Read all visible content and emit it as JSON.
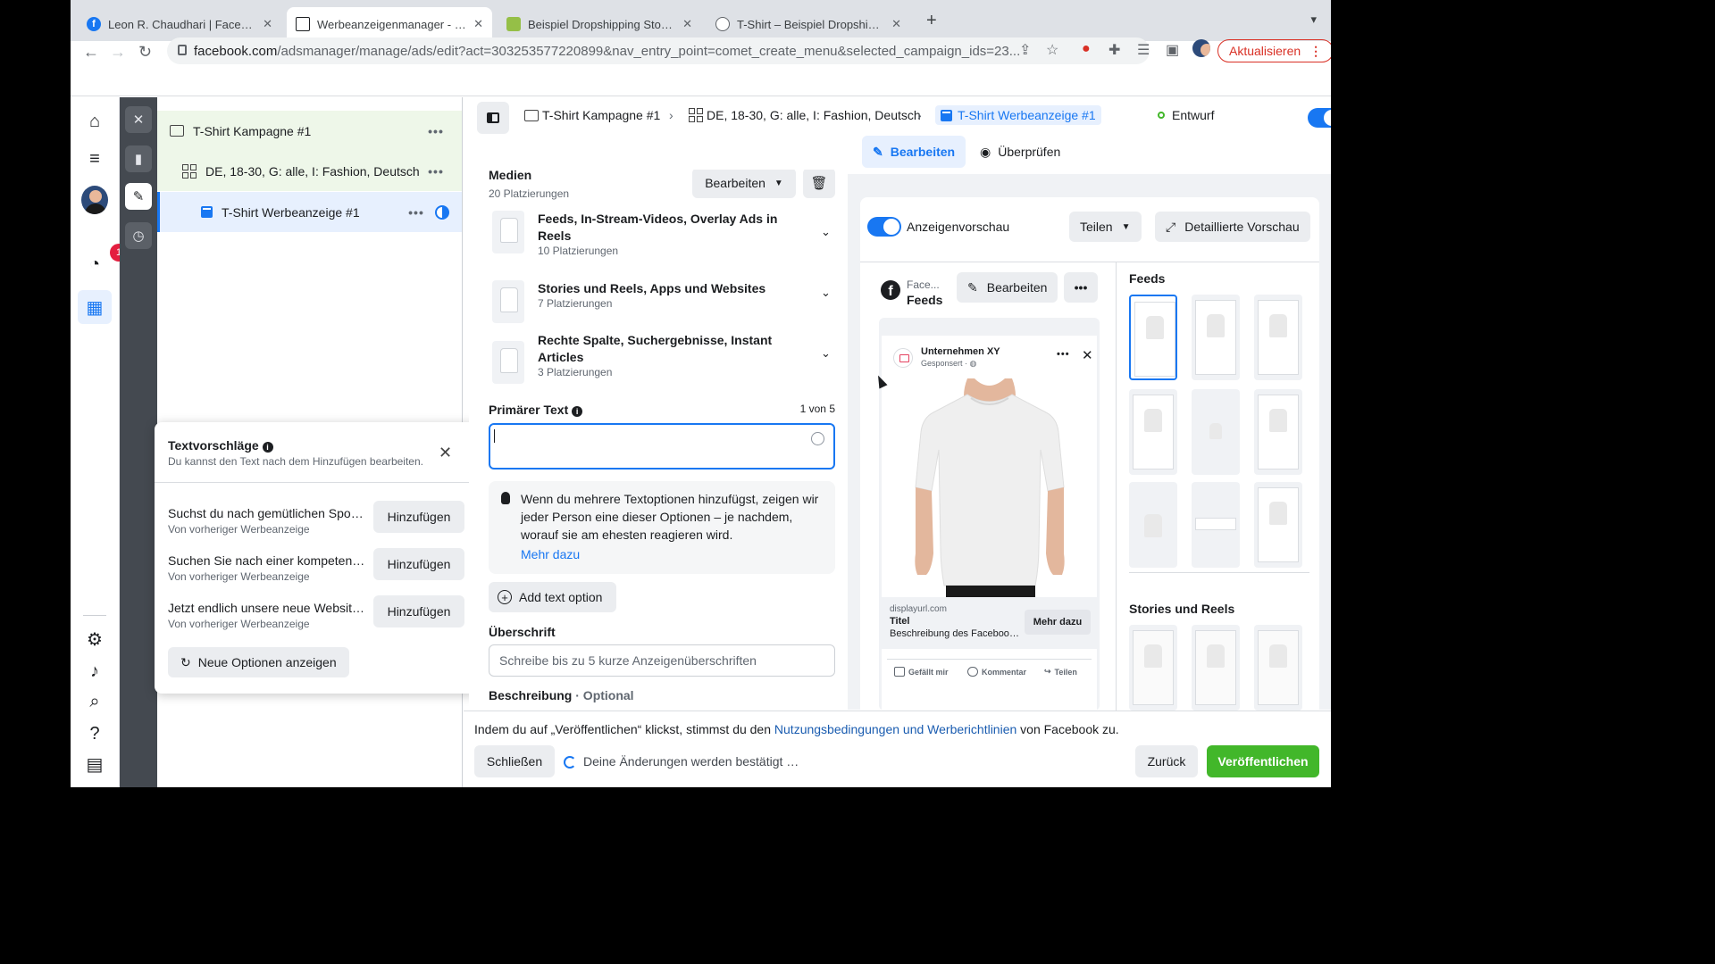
{
  "browser": {
    "tabs": [
      {
        "title": "Leon R. Chaudhari | Facebook",
        "icon": "facebook-icon",
        "color": "#1877f2"
      },
      {
        "title": "Werbeanzeigenmanager - Werbeanzeigen",
        "icon": "ads-manager-icon",
        "color": "#1c1e21"
      },
      {
        "title": "Beispiel Dropshipping Store · Home",
        "icon": "shopify-icon",
        "color": "#95bf47"
      },
      {
        "title": "T-Shirt – Beispiel Dropshipping Store",
        "icon": "globe-icon",
        "color": "#5f6368"
      }
    ],
    "url_host": "facebook.com",
    "url_path": "/adsmanager/manage/ads/edit?act=303253577220899&nav_entry_point=comet_create_menu&selected_campaign_ids=23...",
    "update_label": "Aktualisieren"
  },
  "rail": {
    "notification_count": "1"
  },
  "tree": {
    "campaign": "T-Shirt Kampagne #1",
    "adset": "DE, 18-30, G: alle, I: Fashion, Deutsch",
    "ad": "T-Shirt Werbeanzeige #1",
    "dots": "•••"
  },
  "suggestions": {
    "title": "Textvorschläge",
    "subtitle": "Du kannst den Text nach dem Hinzufügen bearbeiten.",
    "items": [
      {
        "text": "Suchst du nach gemütlichen Sport...",
        "source": "Von vorheriger Werbeanzeige"
      },
      {
        "text": "Suchen Sie nach einer kompetente...",
        "source": "Von vorheriger Werbeanzeige"
      },
      {
        "text": "Jetzt endlich unsere neue Website ...",
        "source": "Von vorheriger Werbeanzeige"
      }
    ],
    "add_label": "Hinzufügen",
    "new_options_label": "Neue Optionen anzeigen"
  },
  "header": {
    "crumbs": [
      "T-Shirt Kampagne #1",
      "DE, 18-30, G: alle, I: Fashion, Deutsch",
      "T-Shirt Werbeanzeige #1"
    ],
    "status": "Entwurf",
    "edit_label": "Bearbeiten",
    "review_label": "Überprüfen"
  },
  "form": {
    "media_title": "Medien",
    "media_count": "20 Platzierungen",
    "media_edit": "Bearbeiten",
    "placements": [
      {
        "title": "Feeds, In-Stream-Videos, Overlay Ads in Reels",
        "count": "10 Platzierungen"
      },
      {
        "title": "Stories und Reels, Apps und Websites",
        "count": "7 Platzierungen"
      },
      {
        "title": "Rechte Spalte, Suchergebnisse, Instant Articles",
        "count": "3 Platzierungen"
      }
    ],
    "primary_text_label": "Primärer Text",
    "primary_text_count": "1 von 5",
    "info_text": "Wenn du mehrere Textoptionen hinzufügst, zeigen wir jeder Person eine dieser Optionen – je nachdem, worauf sie am ehesten reagieren wird.",
    "info_more": "Mehr dazu",
    "add_text_option": "Add text option",
    "headline_label": "Überschrift",
    "headline_placeholder": "Schreibe bis zu 5 kurze Anzeigenüberschriften",
    "description_label": "Beschreibung",
    "description_optional": " · Optional"
  },
  "preview": {
    "toggle_label": "Anzeigenvorschau",
    "share_label": "Teilen",
    "detail_label": "Detaillierte Vorschau",
    "platform_short": "Face...",
    "platform_feed": "Feeds",
    "edit_label": "Bearbeiten",
    "post": {
      "company": "Unternehmen XY",
      "sponsored": "Gesponsert · ",
      "display_url": "displayurl.com",
      "title": "Titel",
      "description": "Beschreibung des Facebook-Links",
      "cta": "Mehr dazu",
      "like": "Gefällt mir",
      "comment": "Kommentar",
      "share": "Teilen"
    },
    "sections": [
      "Feeds",
      "Stories und Reels"
    ]
  },
  "footer": {
    "terms_pre": "Indem du auf „Veröffentlichen“ klickst, stimmst du den ",
    "terms_link": "Nutzungsbedingungen und Werberichtlinien",
    "terms_post": " von Facebook zu.",
    "close_label": "Schließen",
    "pending_text": "Deine Änderungen werden bestätigt …",
    "back_label": "Zurück",
    "publish_label": "Veröffentlichen"
  }
}
